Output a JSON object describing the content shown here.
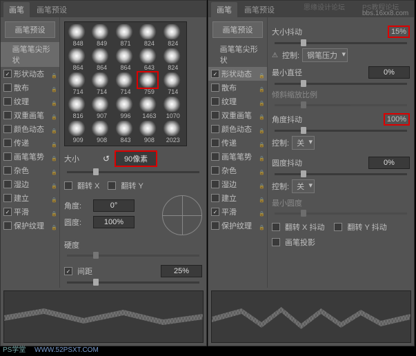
{
  "tabs": {
    "brush": "画笔",
    "presets": "画笔预设"
  },
  "presetBtn": "画笔预设",
  "sidebar": {
    "items": [
      {
        "label": "画笔笔尖形状",
        "sel": true,
        "cb": null
      },
      {
        "label": "形状动态",
        "cb": true
      },
      {
        "label": "散布",
        "cb": false
      },
      {
        "label": "纹理",
        "cb": false
      },
      {
        "label": "双重画笔",
        "cb": false
      },
      {
        "label": "颜色动态",
        "cb": false
      },
      {
        "label": "传递",
        "cb": false
      },
      {
        "label": "画笔笔势",
        "cb": false
      },
      {
        "label": "杂色",
        "cb": false
      },
      {
        "label": "湿边",
        "cb": false
      },
      {
        "label": "建立",
        "cb": false
      },
      {
        "label": "平滑",
        "cb": true
      },
      {
        "label": "保护纹理",
        "cb": false
      }
    ]
  },
  "thumbs": [
    [
      "848",
      "849",
      "871",
      "824",
      "824"
    ],
    [
      "864",
      "864",
      "864",
      "643",
      "824"
    ],
    [
      "714",
      "714",
      "714",
      "759",
      "714"
    ],
    [
      "816",
      "907",
      "996",
      "1463",
      "1070"
    ],
    [
      "909",
      "908",
      "843",
      "908",
      "2023"
    ]
  ],
  "selThumb": "759",
  "left": {
    "sizeLabel": "大小",
    "sizeVal": "90",
    "sizeUnit": "像素",
    "flipX": "翻转 X",
    "flipY": "翻转 Y",
    "angleLabel": "角度:",
    "angleVal": "0°",
    "roundLabel": "圆度:",
    "roundVal": "100%",
    "hardLabel": "硬度",
    "spacingLabel": "间距",
    "spacingVal": "25%"
  },
  "right": {
    "sizeJitterLabel": "大小抖动",
    "sizeJitterVal": "15%",
    "controlLabel": "控制:",
    "controlVal": "钢笔压力",
    "minDiaLabel": "最小直径",
    "minDiaVal": "0%",
    "tiltLabel": "倾斜缩放比例",
    "angleJitterLabel": "角度抖动",
    "angleJitterVal": "100%",
    "control2Label": "控制:",
    "control2Val": "关",
    "roundJitterLabel": "圆度抖动",
    "roundJitterVal": "0%",
    "control3Label": "控制:",
    "control3Val": "关",
    "minRoundLabel": "最小圆度",
    "flipXJitter": "翻转 X 抖动",
    "flipYJitter": "翻转 Y 抖动",
    "brushProj": "画笔投影"
  },
  "sidebar2Sel": 1,
  "wm": {
    "a": "思缘设计论坛",
    "b": "PS教程论坛",
    "c": "bbs.16xx8.com",
    "d": "PS学堂",
    "e": "WWW.52PSXT.COM"
  }
}
